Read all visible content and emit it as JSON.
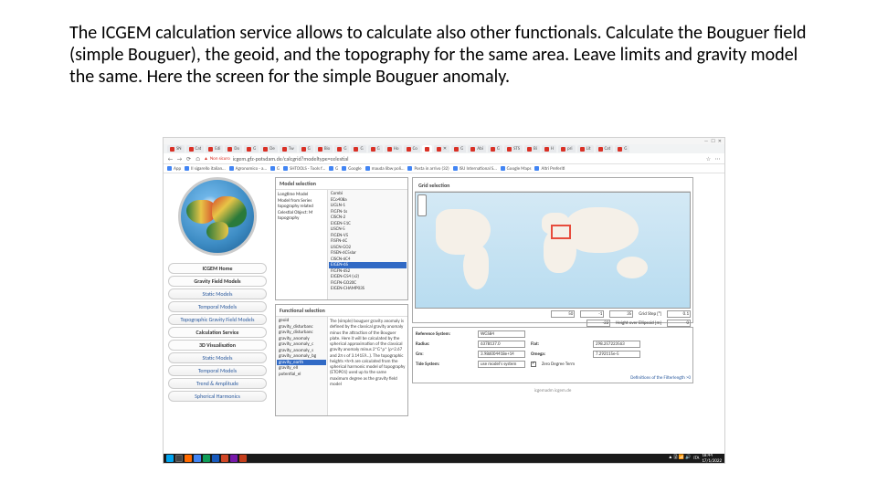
{
  "instruction": "The ICGEM calculation service allows to calculate also other functionals. Calculate the Bouguer field (simple Bouguer), the geoid, and the topography for the same area. Leave limits and gravity model the same. Here the screen for the simple Bouguer anomaly.",
  "browser": {
    "title_controls": {
      "min": "—",
      "max": "☐",
      "close": "✕"
    },
    "tabs": [
      "SN",
      "Cat",
      "Edi",
      "Do",
      "G",
      "De",
      "Tw",
      "G",
      "Bio",
      "G",
      "G",
      "G",
      "Ho",
      "Co",
      "",
      "✕",
      "G",
      "Abi",
      "G",
      "STS",
      "Bi",
      "H",
      "pri",
      "Lit",
      "Cat",
      "G"
    ],
    "nav": {
      "back": "←",
      "fwd": "→",
      "reload": "⟳",
      "home": "⌂"
    },
    "security": "Non sicuro",
    "url": "icgem.gfz-potsdam.de/calcgrid?modeltype=celestial",
    "star": "☆",
    "ext": "⋯",
    "bookmarks": [
      "App",
      "Il sigarello italian…",
      "Agronomico - a…",
      "G",
      "SHTOOLS - Tools f…",
      "G",
      "Google",
      "mauda libw poli…",
      "Posta in arrivo (32)",
      "ISU International S…",
      "Google Maps",
      "Altri Preferiti"
    ]
  },
  "sidebar_menu": [
    {
      "label": "ICGEM Home",
      "cls": "plain"
    },
    {
      "label": "Gravity Field Models",
      "cls": "plain"
    },
    {
      "label": "Static Models",
      "cls": "sub"
    },
    {
      "label": "Temporal Models",
      "cls": "sub"
    },
    {
      "label": "Topographic Gravity Field Models",
      "cls": "sub"
    },
    {
      "label": "Calculation Service",
      "cls": "plain"
    },
    {
      "label": "3D Visualisation",
      "cls": "plain"
    },
    {
      "label": "Static Models",
      "cls": "sub"
    },
    {
      "label": "Temporal Models",
      "cls": "sub"
    },
    {
      "label": "Trend & Amplitude",
      "cls": "sub"
    },
    {
      "label": "Spherical Harmonics",
      "cls": "sub"
    }
  ],
  "model_sel": {
    "heading": "Model selection",
    "labels": "Longtime Model\nModel from Series\ntopography related\nCelestial Object: M\ntopography",
    "list": [
      "Combi",
      "ECo408a",
      "LIGLN-1",
      "FIGFN-1s",
      "CISCN-2",
      "EIGEN-51C",
      "LISCN-5",
      "FIGEN-V5",
      "FISFN-6C",
      "LISCN-GO2",
      "FISEN-6C5slar",
      "CISCN-6C4",
      "EIGEN-6S",
      "FIGFN-6S2",
      "EIGEN-GS4 (v2)",
      "FIGFN-GO20C",
      "EIGEN-CHAMP03S"
    ]
  },
  "func_sel": {
    "heading": "Functional selection",
    "list": [
      "geoid",
      "gravity_disturbanc",
      "gravity_disturbanc",
      "gravity_anomaly",
      "gravity_anomaly_c",
      "gravity_anomaly_s",
      "gravity_anomaly_bg",
      "gravity_earth",
      "gravity_ell",
      "potential_el"
    ],
    "desc": "The (simple) bouguer gravity anomaly is defined by the classical gravity anomaly minus the attraction of the Bouguer plate. Here it will be calculated by the spherical approximation of the classical gravity anomaly minus  2*G*ρ* (ρ=2.67 and 2π s of 3.14159…). The topographic heights ×h×h are calculated from the spherical harmonic model of topography (ETOPO1) used up to the same maximum degree as the gravity field model"
  },
  "grid": {
    "heading": "Grid selection",
    "row1": {
      "a": "50",
      "b": "-1",
      "c": "35",
      "gridstep_label": "Grid Step [°]",
      "gridstep": "0.1"
    },
    "row2": {
      "a": "-22",
      "he_label": "Height over Ellipsoid [m]",
      "he": "0"
    }
  },
  "params": {
    "refsys_label": "Reference System:",
    "refsys": "WGS84",
    "radius_label": "Radius:",
    "radius": "6378137.0",
    "flat_label": "Flat:",
    "flat": "298.257223563",
    "gm_label": "Gm:",
    "gm": "3.986004418e+14",
    "omega_label": "Omega:",
    "omega": "7.292115e-5",
    "tide_label": "Tide System:",
    "tide": "use model's system",
    "zero_label": "Zero Degree Term",
    "def_link": "Definitions of the Filterlength >0"
  },
  "footer": "icgemadm icgem.de",
  "taskbar": {
    "lang": "ITA",
    "time": "18:44",
    "date": "17/1/2022"
  }
}
